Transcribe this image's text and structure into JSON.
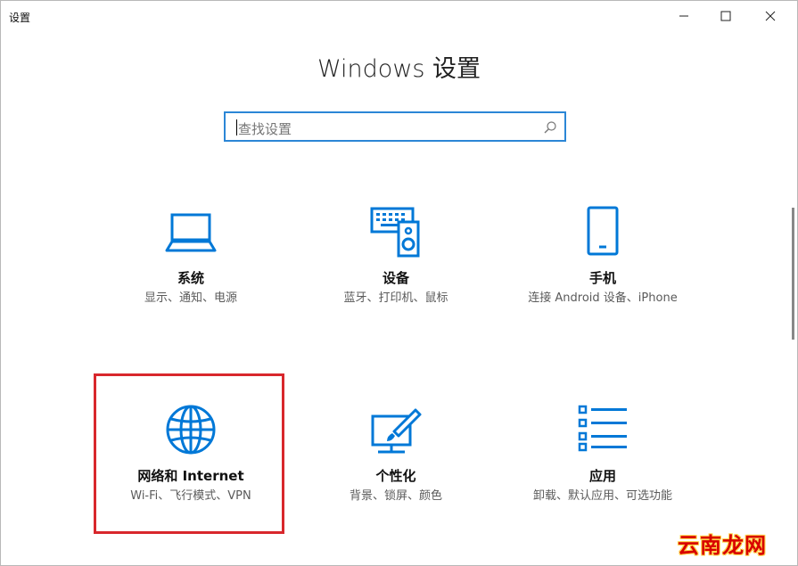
{
  "window": {
    "title": "设置",
    "controls": [
      "minimize",
      "maximize",
      "close"
    ]
  },
  "heading": "Windows 设置",
  "search": {
    "placeholder": "查找设置",
    "icon": "search-icon"
  },
  "tiles": [
    {
      "name": "系统",
      "desc": "显示、通知、电源",
      "icon": "laptop-icon"
    },
    {
      "name": "设备",
      "desc": "蓝牙、打印机、鼠标",
      "icon": "devices-icon"
    },
    {
      "name": "手机",
      "desc": "连接 Android 设备、iPhone",
      "icon": "phone-icon"
    },
    {
      "name": "网络和 Internet",
      "desc": "Wi-Fi、飞行模式、VPN",
      "icon": "globe-icon"
    },
    {
      "name": "个性化",
      "desc": "背景、锁屏、颜色",
      "icon": "personalization-icon"
    },
    {
      "name": "应用",
      "desc": "卸载、默认应用、可选功能",
      "icon": "apps-list-icon"
    }
  ],
  "colors": {
    "accent": "#0078d7",
    "search_border": "#2b86d6",
    "highlight": "#d8272c"
  },
  "watermark": "云南龙网"
}
